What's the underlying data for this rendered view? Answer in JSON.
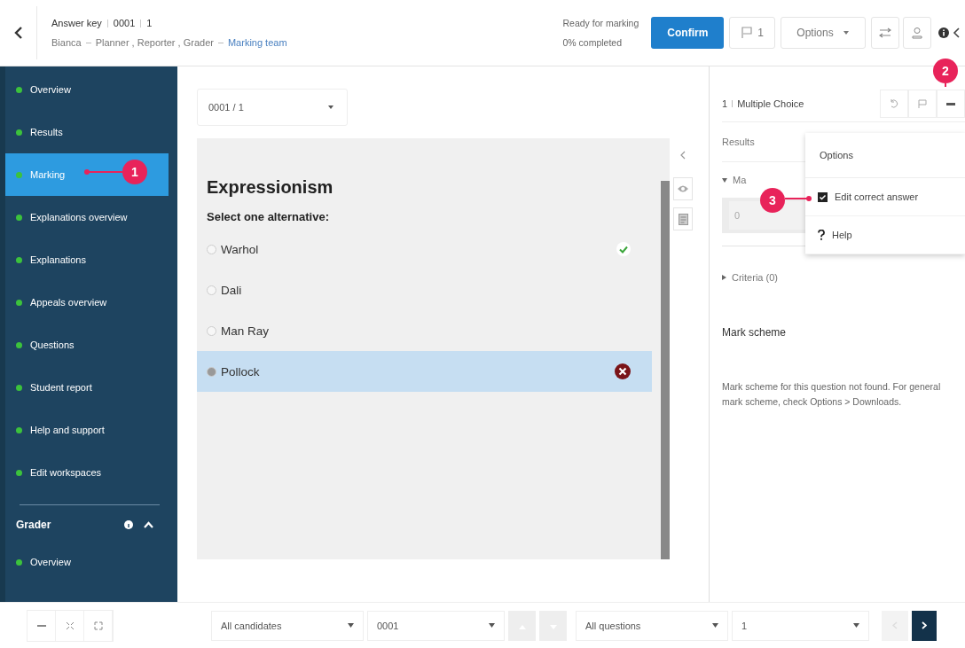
{
  "header": {
    "title_parts": [
      "Answer key",
      "0001",
      "1"
    ],
    "user": "Bianca",
    "roles": "Planner , Reporter , Grader",
    "team": "Marking team",
    "status": "Ready for marking",
    "progress": "0% completed",
    "confirm": "Confirm",
    "flag_count": "1",
    "options": "Options"
  },
  "sidebar": {
    "items": [
      {
        "label": "Overview",
        "selected": false
      },
      {
        "label": "Results",
        "selected": false
      },
      {
        "label": "Marking",
        "selected": true
      },
      {
        "label": "Explanations overview",
        "selected": false
      },
      {
        "label": "Explanations",
        "selected": false
      },
      {
        "label": "Appeals overview",
        "selected": false
      },
      {
        "label": "Questions",
        "selected": false
      },
      {
        "label": "Student report",
        "selected": false
      },
      {
        "label": "Help and support",
        "selected": false
      },
      {
        "label": "Edit workspaces",
        "selected": false
      }
    ],
    "section": {
      "title": "Grader",
      "expanded": true,
      "items": [
        {
          "label": "Overview",
          "selected": false
        }
      ]
    }
  },
  "question": {
    "picker": "0001 / 1",
    "title": "Expressionism",
    "instruction": "Select one alternative:",
    "options": [
      {
        "label": "Warhol",
        "selected": false,
        "kind": "correct"
      },
      {
        "label": "Dali",
        "selected": false,
        "kind": "plain"
      },
      {
        "label": "Man Ray",
        "selected": false,
        "kind": "plain"
      },
      {
        "label": "Pollock",
        "selected": true,
        "kind": "wrong"
      }
    ]
  },
  "panel": {
    "number": "1",
    "type": "Multiple Choice",
    "results": "Results",
    "marks_partial": "Ma",
    "score": "0",
    "criteria": "Criteria (0)",
    "mark_scheme_title": "Mark scheme",
    "mark_scheme_text": "Mark scheme for this question not found. For general mark scheme, check Options > Downloads."
  },
  "menu": {
    "title": "Options",
    "items": [
      {
        "kind": "checkbox",
        "label": "Edit correct answer",
        "checked": true
      },
      {
        "kind": "help",
        "label": "Help"
      }
    ]
  },
  "callouts": [
    "1",
    "2",
    "3"
  ],
  "footer": {
    "candidates": "All candidates",
    "candidate": "0001",
    "questions": "All questions",
    "question": "1"
  }
}
